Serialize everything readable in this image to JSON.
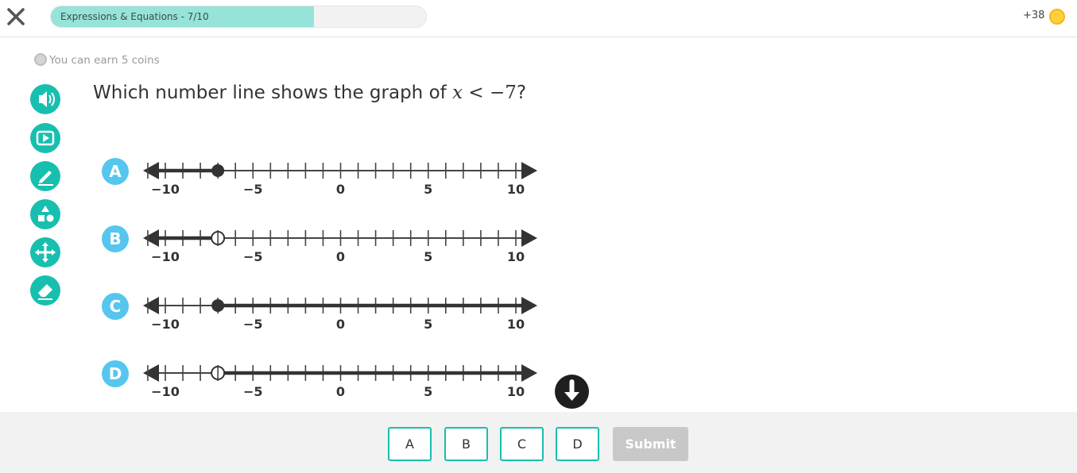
{
  "header": {
    "progress_label": "Expressions & Equations - 7/10",
    "progress_fraction": 0.7,
    "coins_count": "+38",
    "coin_color": "#ffcf3a"
  },
  "earn_coins_text": "You can earn 5 coins",
  "tools": [
    {
      "name": "read-aloud-icon"
    },
    {
      "name": "video-icon"
    },
    {
      "name": "pencil-icon"
    },
    {
      "name": "shapes-icon"
    },
    {
      "name": "move-icon"
    },
    {
      "name": "eraser-icon"
    }
  ],
  "question": {
    "prefix": "Which number line shows the graph of ",
    "var": "x",
    "op": " < ",
    "num": "−7",
    "suffix": "?"
  },
  "number_line": {
    "min": -11,
    "max": 10,
    "tick_labels": [
      {
        "value": -10,
        "label": "−10"
      },
      {
        "value": -5,
        "label": "−5"
      },
      {
        "value": 0,
        "label": "0"
      },
      {
        "value": 5,
        "label": "5"
      },
      {
        "value": 10,
        "label": "10"
      }
    ]
  },
  "choices": [
    {
      "letter": "A",
      "point": -7,
      "closed": true,
      "direction": "left"
    },
    {
      "letter": "B",
      "point": -7,
      "closed": false,
      "direction": "left"
    },
    {
      "letter": "C",
      "point": -7,
      "closed": true,
      "direction": "right"
    },
    {
      "letter": "D",
      "point": -7,
      "closed": false,
      "direction": "right"
    }
  ],
  "answer_buttons": [
    "A",
    "B",
    "C",
    "D"
  ],
  "submit_label": "Submit",
  "colors": {
    "accent": "#17bfae",
    "badge": "#56c6ef",
    "progress_fill": "#96e3d9"
  }
}
